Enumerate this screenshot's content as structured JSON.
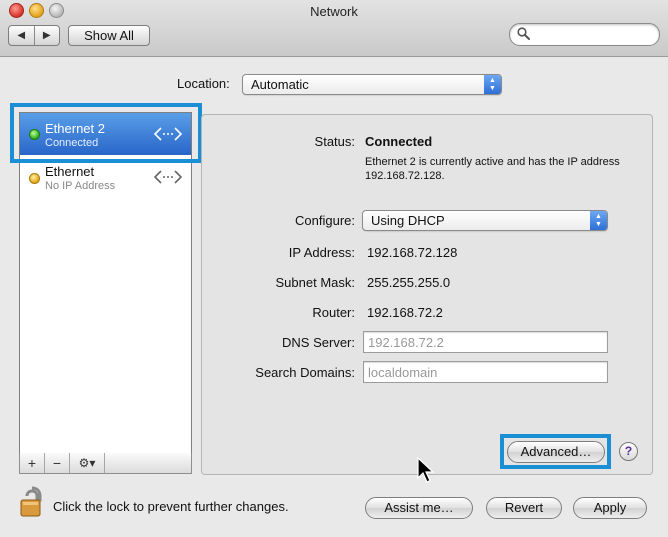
{
  "window": {
    "title": "Network"
  },
  "toolbar": {
    "back_glyph": "◀",
    "forward_glyph": "▶",
    "show_all_label": "Show All",
    "search": {
      "placeholder": "",
      "value": ""
    }
  },
  "location": {
    "label": "Location:",
    "value": "Automatic"
  },
  "services": [
    {
      "name": "Ethernet 2",
      "status": "Connected",
      "status_color": "#2fae14",
      "icon": "ethernet-arrows-icon",
      "selected": true
    },
    {
      "name": "Ethernet",
      "status": "No IP Address",
      "status_color": "#e3a618",
      "icon": "ethernet-arrows-icon",
      "selected": false
    }
  ],
  "list_toolbar": {
    "add_glyph": "+",
    "remove_glyph": "−",
    "gear_glyph": "⚙▾"
  },
  "detail": {
    "status_label": "Status:",
    "status_value": "Connected",
    "status_description": "Ethernet 2 is currently active and has the IP address 192.168.72.128.",
    "configure_label": "Configure:",
    "configure_value": "Using DHCP",
    "ip_label": "IP Address:",
    "ip_value": "192.168.72.128",
    "subnet_label": "Subnet Mask:",
    "subnet_value": "255.255.255.0",
    "router_label": "Router:",
    "router_value": "192.168.72.2",
    "dns_label": "DNS Server:",
    "dns_placeholder": "192.168.72.2",
    "search_domains_label": "Search Domains:",
    "search_domains_placeholder": "localdomain",
    "advanced_label": "Advanced…",
    "help_glyph": "?"
  },
  "footer": {
    "lock_text": "Click the lock to prevent further changes.",
    "assist_label": "Assist me…",
    "revert_label": "Revert",
    "apply_label": "Apply"
  },
  "colors": {
    "selection_blue": "#2866c9",
    "highlight_box": "#1b8fd6",
    "status_connected": "#2fae14",
    "status_no_ip": "#e3a618"
  }
}
